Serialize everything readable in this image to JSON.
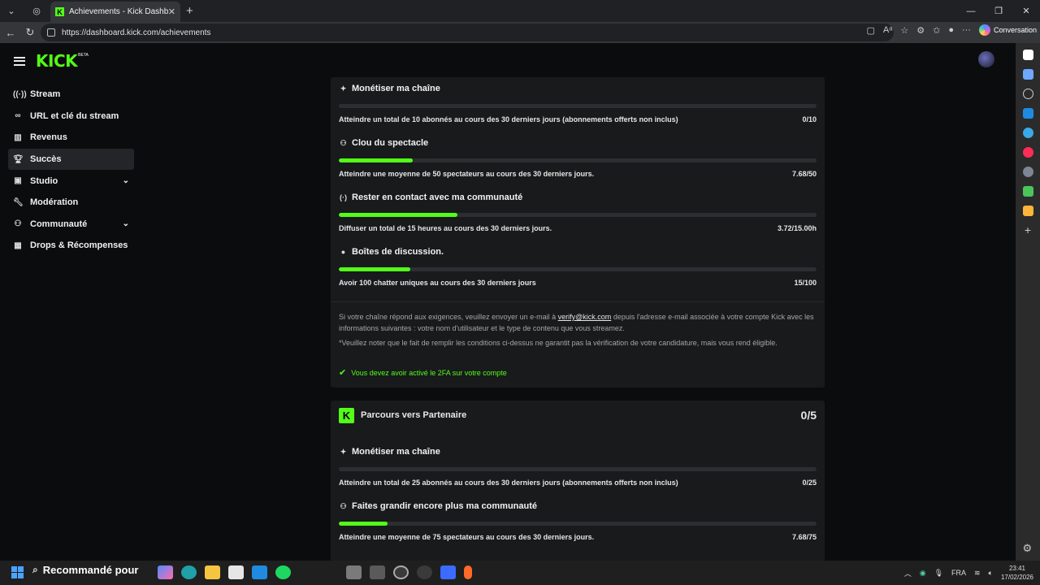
{
  "browser": {
    "tab_title": "Achievements - Kick Dashboard",
    "url": "https://dashboard.kick.com/achievements",
    "conversation_label": "Conversation"
  },
  "app": {
    "logo": "KICK",
    "logo_badge": "BETA"
  },
  "sidebar": {
    "items": [
      {
        "label": "Stream",
        "icon": "broadcast-icon"
      },
      {
        "label": "URL et clé du stream",
        "icon": "link-icon"
      },
      {
        "label": "Revenus",
        "icon": "chart-icon"
      },
      {
        "label": "Succès",
        "icon": "trophy-icon",
        "active": true
      },
      {
        "label": "Studio",
        "icon": "studio-icon",
        "expandable": true
      },
      {
        "label": "Modération",
        "icon": "wrench-icon"
      },
      {
        "label": "Communauté",
        "icon": "people-icon",
        "expandable": true
      },
      {
        "label": "Drops & Récompenses",
        "icon": "drops-icon"
      }
    ]
  },
  "affiliate": {
    "achievements": [
      {
        "title": "Monétiser ma chaîne",
        "icon": "sparkle-icon",
        "desc": "Atteindre un total de 10 abonnés au cours des 30 derniers jours (abonnements offerts non inclus)",
        "value": "0/10",
        "progress": 0
      },
      {
        "title": "Clou du spectacle",
        "icon": "viewers-icon",
        "desc": "Atteindre une moyenne de 50 spectateurs au cours des 30 derniers jours.",
        "value": "7.68/50",
        "progress": 0.154
      },
      {
        "title": "Rester en contact avec ma communauté",
        "icon": "signal-icon",
        "desc": "Diffuser un total de 15 heures au cours des 30 derniers jours.",
        "value": "3.72/15.00h",
        "progress": 0.248
      },
      {
        "title": "Boîtes de discussion.",
        "icon": "chat-icon",
        "desc": "Avoir 100 chatter uniques au cours des 30 derniers jours",
        "value": "15/100",
        "progress": 0.15
      }
    ],
    "note1_a": "Si votre chaîne répond aux exigences, veuillez envoyer un e-mail à ",
    "note1_link": "verify@kick.com",
    "note1_b": " depuis l'adresse e-mail associée à votre compte Kick avec les informations suivantes : votre nom d'utilisateur et le type de contenu que vous streamez.",
    "note2": "*Veuillez noter que le fait de remplir les conditions ci-dessus ne garantit pas la vérification de votre candidature, mais vous rend éligible.",
    "requirement": "Vous devez avoir activé le 2FA sur votre compte"
  },
  "partner": {
    "title": "Parcours vers Partenaire",
    "count": "0/5",
    "achievements": [
      {
        "title": "Monétiser ma chaîne",
        "icon": "sparkle-icon",
        "desc": "Atteindre un total de 25 abonnés au cours des 30 derniers jours (abonnements offerts non inclus)",
        "value": "0/25",
        "progress": 0
      },
      {
        "title": "Faites grandir encore plus ma communauté",
        "icon": "viewers-icon",
        "desc": "Atteindre une moyenne de 75 spectateurs au cours des 30 derniers jours.",
        "value": "7.68/75",
        "progress": 0.102
      }
    ]
  },
  "taskbar": {
    "search_text": "Recommandé pour",
    "lang": "FRA",
    "time": "23:41",
    "date": "17/02/2026"
  },
  "colors": {
    "accent": "#53fc18",
    "card_bg": "#181a1c",
    "page_bg": "#0b0c0d"
  }
}
